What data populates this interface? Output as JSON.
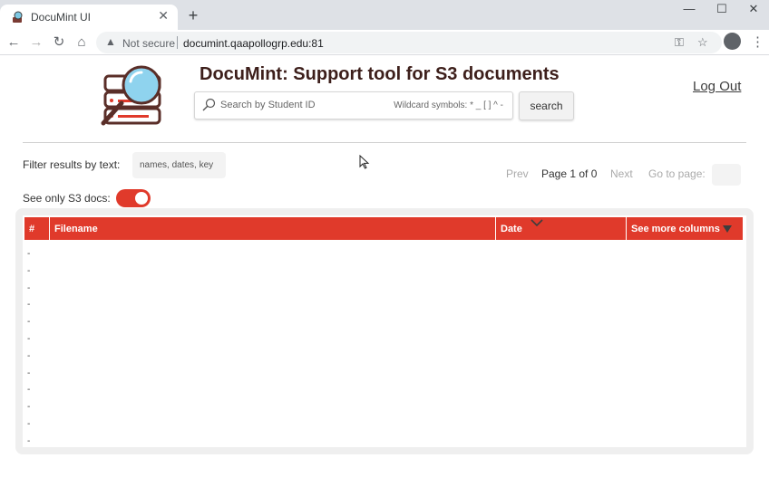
{
  "browser": {
    "tab_title": "DocuMint UI",
    "tab_close": "✕",
    "new_tab": "+",
    "minimize": "—",
    "maximize": "☐",
    "close": "✕",
    "back": "←",
    "forward": "→",
    "reload": "↻",
    "home": "⌂",
    "security_icon": "▲",
    "security_text": "Not secure",
    "url": "documint.qaapollogrp.edu:81",
    "key_icon": "⚿",
    "star_icon": "☆",
    "menu_icon": "⋮"
  },
  "app": {
    "title": "DocuMint: Support tool for S3 documents",
    "logout": "Log Out",
    "search": {
      "placeholder": "Search by Student ID",
      "wildcard_hint": "Wildcard symbols: * _ [ ] ^ -",
      "button": "search"
    },
    "filter": {
      "label": "Filter results by text:",
      "placeholder": "names, dates, key"
    },
    "pager": {
      "prev": "Prev",
      "info": "Page 1 of 0",
      "next": "Next",
      "goto_label": "Go to page:"
    },
    "s3_only": {
      "label": "See only S3 docs:",
      "enabled": true
    },
    "table": {
      "columns": [
        "#",
        "Filename",
        "Date",
        "See more columns"
      ],
      "rows": [
        "-",
        "-",
        "-",
        "-",
        "-",
        "-",
        "-",
        "-",
        "-",
        "-",
        "-",
        "-"
      ]
    }
  },
  "colors": {
    "accent": "#e03a2b",
    "title": "#3d1f1b"
  }
}
